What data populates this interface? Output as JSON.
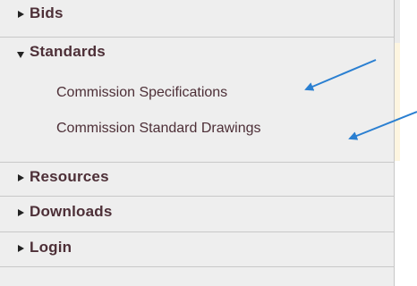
{
  "menu": {
    "items": [
      {
        "label": "Bids",
        "state": "collapsed"
      },
      {
        "label": "Standards",
        "state": "expanded",
        "children": [
          {
            "label": "Commission Specifications"
          },
          {
            "label": "Commission Standard Drawings"
          }
        ]
      },
      {
        "label": "Resources",
        "state": "collapsed"
      },
      {
        "label": "Downloads",
        "state": "collapsed"
      },
      {
        "label": "Login",
        "state": "collapsed"
      }
    ]
  },
  "colors": {
    "menu_text": "#4d2f37",
    "menu_bg": "#eeeeee",
    "divider": "#c8c8c8",
    "annotation_arrow": "#2a7fd1"
  },
  "icons": {
    "collapsed": "triangle-right-icon",
    "expanded": "triangle-down-icon"
  }
}
